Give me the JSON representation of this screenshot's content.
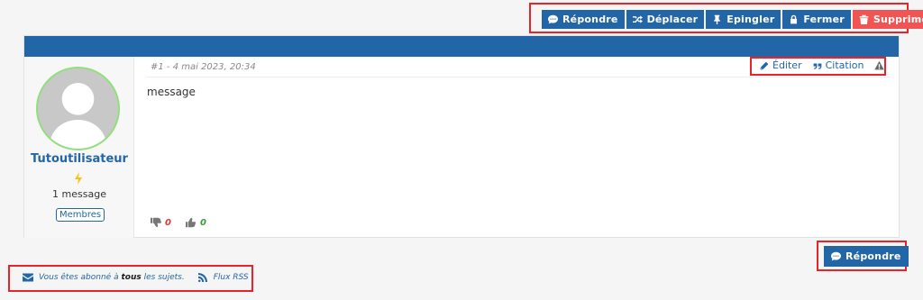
{
  "topbar": {
    "buttons": [
      {
        "label": "Répondre",
        "icon": "speech-bubble-icon"
      },
      {
        "label": "Déplacer",
        "icon": "shuffle-icon"
      },
      {
        "label": "Epingler",
        "icon": "pin-icon"
      },
      {
        "label": "Fermer",
        "icon": "lock-icon"
      },
      {
        "label": "Supprimer",
        "icon": "trash-icon",
        "color": "#f15553"
      }
    ]
  },
  "post": {
    "meta": "#1 - 4 mai 2023, 20:34",
    "actions": {
      "edit": "Éditer",
      "quote": "Citation"
    },
    "message": "message",
    "dislikes": "0",
    "likes": "0"
  },
  "author": {
    "username": "Tutoutilisateur",
    "message_count": "1 message",
    "group": "Membres"
  },
  "reply_button": "Répondre",
  "footer": {
    "subscribed_prefix": "Vous êtes abonné à",
    "subscribed_bold": "tous",
    "subscribed_suffix": "les sujets.",
    "rss": "Flux RSS"
  },
  "colors": {
    "primary": "#2366a8",
    "danger": "#f15553",
    "highlight": "#e8232a"
  }
}
